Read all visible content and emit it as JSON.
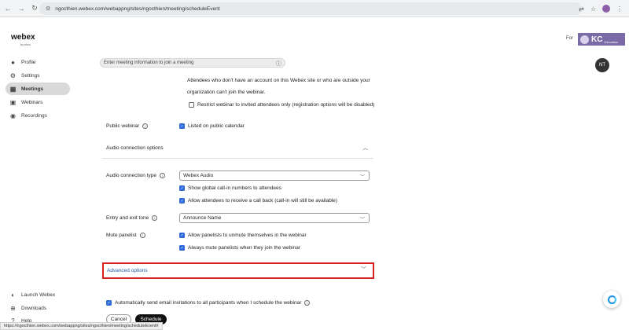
{
  "browser": {
    "url": "ngocthien.webex.com/webappng/sites/ngocthien/meeting/scheduleEvent"
  },
  "header": {
    "logo": "webex",
    "logo_sub": "by cisco",
    "for_label": "For",
    "brand_text": "KC",
    "brand_sub": "Education",
    "search_placeholder": "Enter meeting information to join a meeting",
    "user_initials": "NT"
  },
  "sidebar": {
    "items": [
      {
        "label": "Profile",
        "icon": "profile-icon"
      },
      {
        "label": "Settings",
        "icon": "gear-icon"
      },
      {
        "label": "Meetings",
        "icon": "calendar-icon"
      },
      {
        "label": "Webinars",
        "icon": "webinar-icon"
      },
      {
        "label": "Recordings",
        "icon": "recording-icon"
      }
    ],
    "bottom": [
      {
        "label": "Launch Webex",
        "icon": "webex-icon"
      },
      {
        "label": "Downloads",
        "icon": "download-icon"
      },
      {
        "label": "Help",
        "icon": "help-icon"
      }
    ]
  },
  "form": {
    "attendees_note_line1": "Attendees who don't have an account on this Webex site or who are outside your",
    "attendees_note_line2": "organization can't join the webinar.",
    "restrict_label": "Restrict webinar to invited attendees only (registration options will be disabled)",
    "public_webinar_label": "Public webinar",
    "listed_label": "Listed on public calendar",
    "audio_section_title": "Audio connection options",
    "audio_type_label": "Audio connection type",
    "audio_type_value": "Webex Audio",
    "show_callin_label": "Show global call-in numbers to attendees",
    "allow_callback_label": "Allow attendees to receive a call back (call-in will still be available)",
    "entry_exit_label": "Entry and exit tone",
    "entry_exit_value": "Announce Name",
    "mute_panelist_label": "Mute panelist",
    "allow_unmute_label": "Allow panelists to unmute themselves in the webinar",
    "always_mute_label": "Always mute panelists when they join the webinar",
    "advanced_options_label": "Advanced options",
    "auto_email_label": "Automatically send email invitations to all participants when I schedule the webinar",
    "cancel_label": "Cancel",
    "schedule_label": "Schedule"
  },
  "status_bar": {
    "url": "https://ngocthien.webex.com/webappng/sites/ngocthien/meeting/scheduleEvent#"
  },
  "colors": {
    "accent": "#2e6bd8",
    "highlight_border": "#d92020",
    "link": "#1f5ba8"
  }
}
